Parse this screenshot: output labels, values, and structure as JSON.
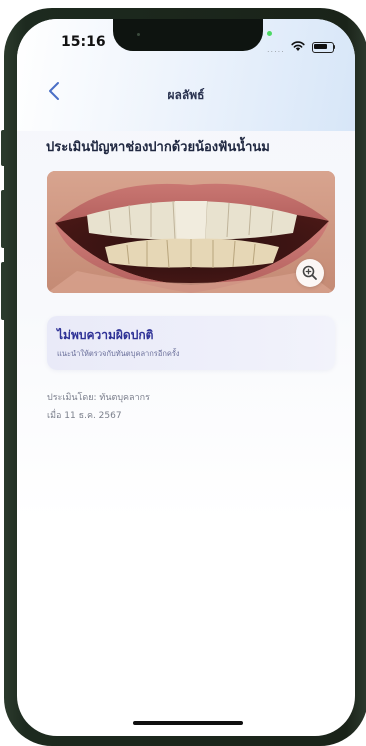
{
  "status_bar": {
    "time": "15:16",
    "cellular": "....."
  },
  "header": {
    "title": "ผลลัพธ์",
    "back_icon": "chevron-left-icon"
  },
  "assessment": {
    "heading": "ประเมินปัญหาช่องปากด้วยน้องฟันน้ำนม",
    "photo": "teeth-photo",
    "zoom_icon": "magnifier-plus-icon"
  },
  "result": {
    "title": "ไม่พบความผิดปกติ",
    "subtitle": "แนะนำให้ตรวจกับทันตบุคลากรอีกครั้ง"
  },
  "meta": {
    "assessed_by": "ประเมินโดย: ทันตบุคลากร",
    "date": "เมื่อ 11 ธ.ค. 2567"
  },
  "colors": {
    "accent": "#2e3196",
    "heading": "#1f2740",
    "card_bg": "#eceefa",
    "meta_text": "#7b7f8c",
    "back_arrow": "#4a6fc6"
  }
}
